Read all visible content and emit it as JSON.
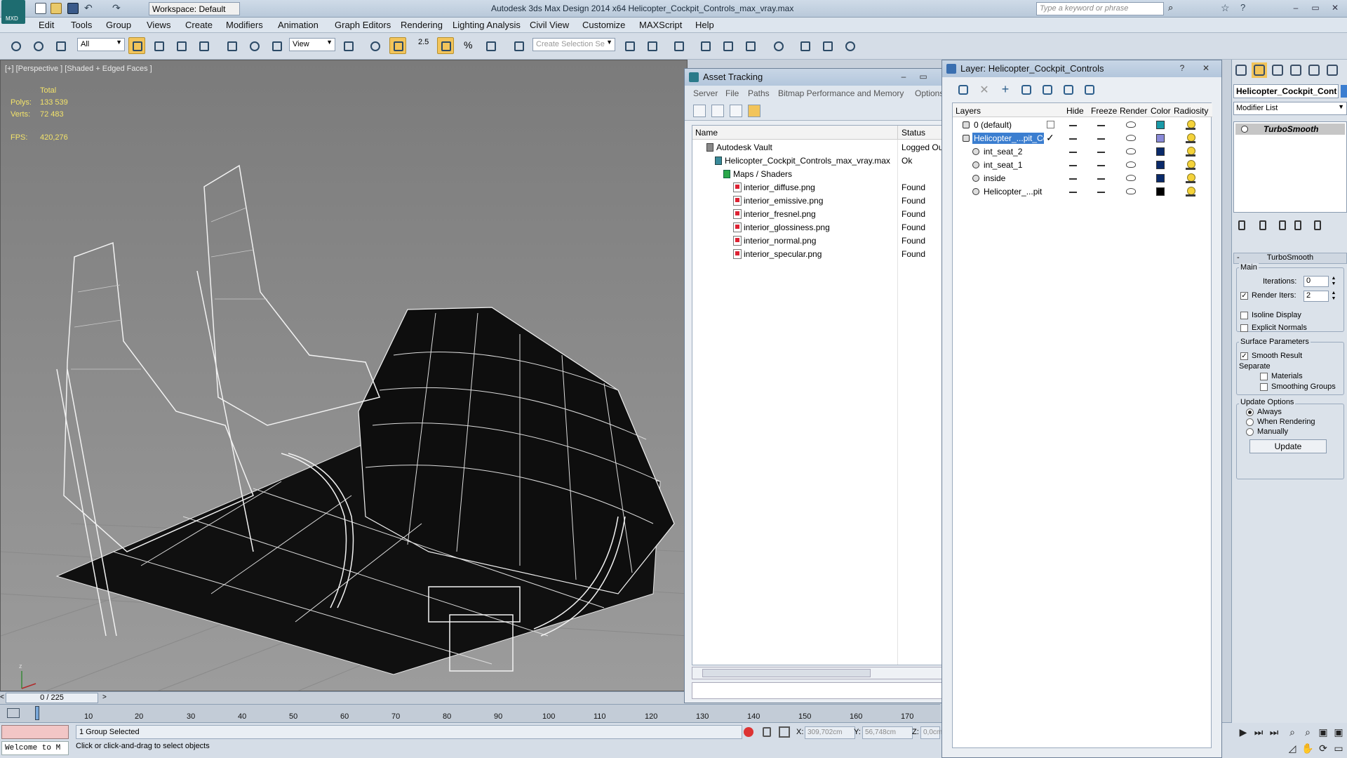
{
  "app": {
    "title": "Autodesk 3ds Max Design 2014 x64     Helicopter_Cockpit_Controls_max_vray.max",
    "logo_text": "MXD",
    "workspace": "Workspace: Default",
    "search_placeholder": "Type a keyword or phrase"
  },
  "menu": [
    "Edit",
    "Tools",
    "Group",
    "Views",
    "Create",
    "Modifiers",
    "Animation",
    "Graph Editors",
    "Rendering",
    "Lighting Analysis",
    "Civil View",
    "Customize",
    "MAXScript",
    "Help"
  ],
  "toolbar": {
    "selection_filter": "All",
    "reference_coord": "View",
    "snap_value": "2.5",
    "named_selection_placeholder": "Create Selection Se"
  },
  "viewport": {
    "label": "[+] [Perspective ] [Shaded + Edged Faces ]",
    "stats_header": "Total",
    "polys_label": "Polys:",
    "polys_value": "133 539",
    "verts_label": "Verts:",
    "verts_value": "72 483",
    "fps_label": "FPS:",
    "fps_value": "420,276"
  },
  "timeline": {
    "frame_display": "0 / 225",
    "ticks": [
      "10",
      "20",
      "30",
      "40",
      "50",
      "60",
      "70",
      "80",
      "90",
      "100",
      "110",
      "120",
      "130",
      "140",
      "150",
      "160",
      "170"
    ]
  },
  "status": {
    "maxscript_text": "Welcome to M",
    "selection": "1 Group Selected",
    "prompt": "Click or click-and-drag to select objects",
    "x_label": "X:",
    "x_value": "309,702cm",
    "y_label": "Y:",
    "y_value": "56,748cm",
    "z_label": "Z:",
    "z_value": "0,0cm"
  },
  "asset_tracking": {
    "title": "Asset Tracking",
    "menu": [
      "Server",
      "File",
      "Paths",
      "Bitmap Performance and Memory",
      "Options"
    ],
    "columns": [
      "Name",
      "Status"
    ],
    "rows": [
      {
        "name": "Autodesk Vault",
        "status": "Logged Out"
      },
      {
        "name": "Helicopter_Cockpit_Controls_max_vray.max",
        "status": "Ok"
      },
      {
        "name": "Maps / Shaders",
        "status": ""
      },
      {
        "name": "interior_diffuse.png",
        "status": "Found"
      },
      {
        "name": "interior_emissive.png",
        "status": "Found"
      },
      {
        "name": "interior_fresnel.png",
        "status": "Found"
      },
      {
        "name": "interior_glossiness.png",
        "status": "Found"
      },
      {
        "name": "interior_normal.png",
        "status": "Found"
      },
      {
        "name": "interior_specular.png",
        "status": "Found"
      }
    ]
  },
  "layer_panel": {
    "title": "Layer: Helicopter_Cockpit_Controls",
    "columns": [
      "Layers",
      "Hide",
      "Freeze",
      "Render",
      "Color",
      "Radiosity"
    ],
    "rows": [
      {
        "name": "0 (default)",
        "color": "#1a9aa8"
      },
      {
        "name": "Helicopter_...pit_Co",
        "color": "#8a8ad8"
      },
      {
        "name": "int_seat_2",
        "color": "#0a2a6a"
      },
      {
        "name": "int_seat_1",
        "color": "#0a2a6a"
      },
      {
        "name": "inside",
        "color": "#0a2a6a"
      },
      {
        "name": "Helicopter_...pit",
        "color": "#000000"
      }
    ]
  },
  "command_panel": {
    "object_name": "Helicopter_Cockpit_Cont",
    "modifier_list": "Modifier List",
    "stack_item": "TurboSmooth",
    "rollout_title": "TurboSmooth",
    "main_label": "Main",
    "iterations_label": "Iterations:",
    "iterations_value": "0",
    "render_iters_label": "Render Iters:",
    "render_iters_value": "2",
    "isoline_label": "Isoline Display",
    "explicit_normals_label": "Explicit Normals",
    "surface_params_label": "Surface Parameters",
    "smooth_result_label": "Smooth Result",
    "separate_label": "Separate",
    "materials_label": "Materials",
    "smoothing_groups_label": "Smoothing Groups",
    "update_options_label": "Update Options",
    "always_label": "Always",
    "when_rendering_label": "When Rendering",
    "manually_label": "Manually",
    "update_button": "Update"
  },
  "colors": {
    "accent": "#f2c45a",
    "selection_blue": "#3b7ed0",
    "stats_yellow": "#f3e36a"
  }
}
